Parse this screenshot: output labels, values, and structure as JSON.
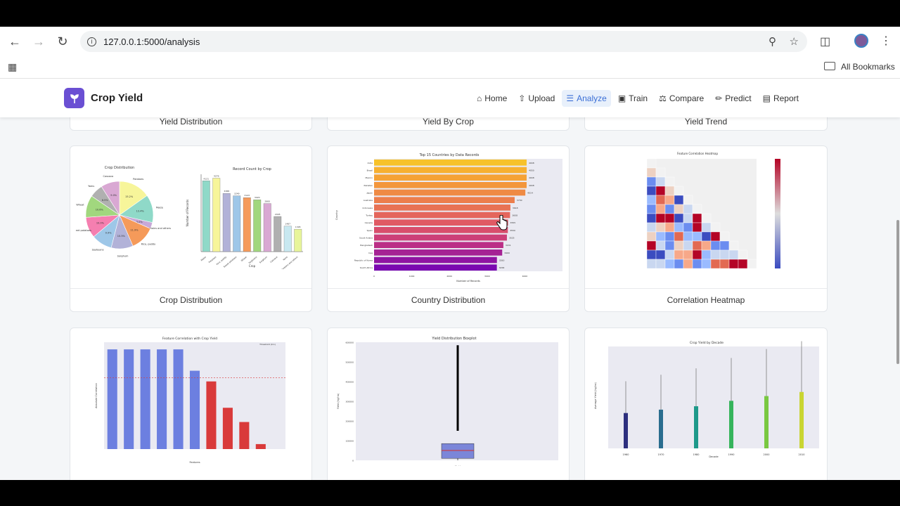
{
  "browser": {
    "url": "127.0.0.1:5000/analysis",
    "bookmarks_label": "All Bookmarks"
  },
  "app": {
    "brand": "Crop Yield",
    "nav": [
      {
        "label": "Home",
        "icon": "home-icon"
      },
      {
        "label": "Upload",
        "icon": "upload-icon"
      },
      {
        "label": "Analyze",
        "icon": "analyze-icon",
        "active": true
      },
      {
        "label": "Train",
        "icon": "robot-icon"
      },
      {
        "label": "Compare",
        "icon": "scale-icon"
      },
      {
        "label": "Predict",
        "icon": "wand-icon"
      },
      {
        "label": "Report",
        "icon": "report-icon"
      }
    ]
  },
  "top_cards": [
    "Yield Distribution",
    "Yield By Crop",
    "Yield Trend"
  ],
  "cards": [
    {
      "title": "Crop Distribution"
    },
    {
      "title": "Country Distribution"
    },
    {
      "title": "Correlation Heatmap"
    }
  ],
  "chart_data": [
    {
      "type": "pie",
      "title": "Crop Distribution",
      "categories": [
        "Potatoes",
        "Maize",
        "Plantains and others",
        "Rice, paddy",
        "Sorghum",
        "Soybeans",
        "Sweet potatoes",
        "Wheat",
        "Yams",
        "Cassava"
      ],
      "values": [
        15.2,
        13.4,
        3.0,
        11.9,
        10.5,
        9.9,
        10.0,
        10.6,
        6.5,
        9.0
      ],
      "colors": [
        "#f7f59a",
        "#8fd9c8",
        "#c8a8d8",
        "#f59a5a",
        "#b2b2d8",
        "#9ec7e8",
        "#f57fb0",
        "#a1d77e",
        "#b0b0b0",
        "#d9a8d3"
      ]
    },
    {
      "type": "bar",
      "title": "Record Count by Crop",
      "xlabel": "Crop",
      "ylabel": "Number of Records",
      "categories": [
        "Maize",
        "Potatoes",
        "Rice, paddy",
        "Sweet potatoes",
        "Wheat",
        "Soybeans",
        "Sorghum",
        "Cassava",
        "Yams",
        "Plantains and others"
      ],
      "values": [
        4121,
        4276,
        3388,
        3249,
        3143,
        3020,
        2800,
        2045,
        1487,
        1305
      ],
      "ylim": [
        0,
        4500
      ]
    },
    {
      "type": "bar",
      "title": "Top 15 Countries by Data Records",
      "xlabel": "Number of Records",
      "ylabel": "Country",
      "categories": [
        "India",
        "Brazil",
        "Mexico",
        "Pakistan",
        "Japan",
        "Australia",
        "Indonesia",
        "Turkey",
        "Canada",
        "Spain",
        "Saudi Arabia",
        "Bangladesh",
        "Iraq",
        "Republic of Korea",
        "South Africa"
      ],
      "values": [
        4048,
        4050,
        4048,
        4048,
        4014,
        3730,
        3618,
        3608,
        3555,
        3550,
        3525,
        3431,
        3400,
        3260,
        3258
      ],
      "xlim": [
        0,
        5000
      ]
    },
    {
      "type": "heatmap",
      "title": "Feature Correlation Heatmap"
    },
    {
      "type": "bar",
      "title": "Feature Correlation with Crop Yield",
      "xlabel": "Features",
      "ylabel": "Absolute Correlation",
      "legend": "Threshold (0.1)",
      "values": [
        0.14,
        0.14,
        0.14,
        0.14,
        0.14,
        0.11,
        0.095,
        0.058,
        0.038,
        0.007,
        0.0
      ],
      "threshold": 0.1,
      "ylim": [
        0,
        0.15
      ]
    },
    {
      "type": "box",
      "title": "Yield Distribution Boxplot",
      "xlabel": "Yield",
      "ylabel": "Yield (hg/ha)",
      "ylim": [
        0,
        600000
      ]
    },
    {
      "type": "bar",
      "title": "Crop Yield by Decade",
      "xlabel": "Decade",
      "ylabel": "Average Yield (hg/ha)",
      "categories": [
        "1960",
        "1970",
        "1980",
        "1990",
        "2000",
        "2010"
      ],
      "values": [
        52000,
        57000,
        62000,
        70000,
        77000,
        83000
      ],
      "colors": [
        "#2d2f7e",
        "#2a6d8f",
        "#1e998a",
        "#36b45c",
        "#79c841",
        "#c9d532"
      ]
    }
  ]
}
